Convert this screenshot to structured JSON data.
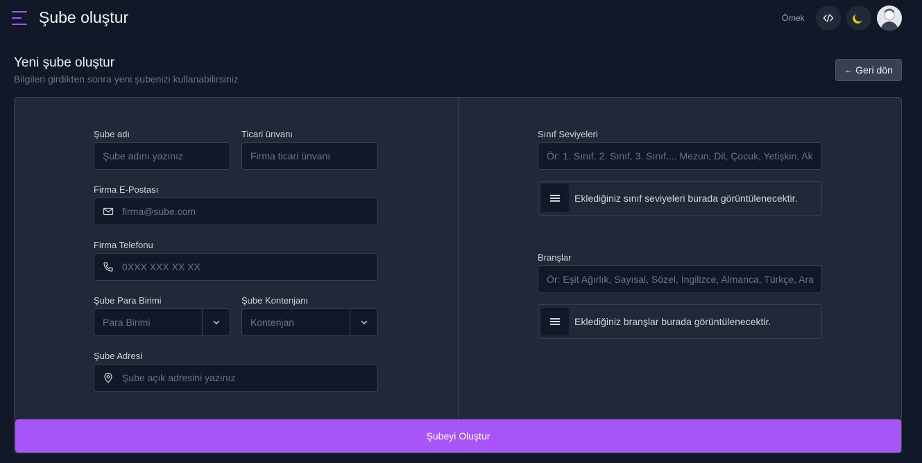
{
  "header": {
    "title": "Şube oluştur",
    "example_label": "Örnek"
  },
  "page": {
    "heading": "Yeni şube oluştur",
    "subheading": "Bilgileri girdikten sonra yeni şubenizi kullanabilirsiniz",
    "back_label": "Geri dön",
    "back_icon": "←"
  },
  "form": {
    "branch_name": {
      "label": "Şube adı",
      "placeholder": "Şube adını yazınız"
    },
    "trade_title": {
      "label": "Ticari ünvanı",
      "placeholder": "Firma ticari ünvanı"
    },
    "email": {
      "label": "Firma E-Postası",
      "placeholder": "firma@sube.com"
    },
    "phone": {
      "label": "Firma Telefonu",
      "placeholder": "0XXX XXX XX XX"
    },
    "currency": {
      "label": "Şube Para Birimi",
      "placeholder": "Para Birimi"
    },
    "quota": {
      "label": "Şube Kontenjanı",
      "placeholder": "Kontenjan"
    },
    "address": {
      "label": "Şube Adresi",
      "placeholder": "Şube açık adresini yazınız"
    },
    "class_levels": {
      "label": "Sınıf Seviyeleri",
      "placeholder": "Ör: 1. Sınıf, 2. Sınıf, 3. Sınıf.... Mezun, Dil, Çocuk, Yetişkin, Ak",
      "empty_text": "Eklediğiniz sınıf seviyeleri burada görüntülenecektir."
    },
    "branches": {
      "label": "Branşlar",
      "placeholder": "Ör: Eşit Ağırlık, Sayısal, Sözel, İngilizce, Almanca, Türkçe, Ara",
      "empty_text": "Eklediğiniz branşlar burada görüntülenecektir."
    },
    "submit_label": "Şubeyi Oluştur"
  },
  "colors": {
    "accent": "#a855f7",
    "background": "#111827",
    "card": "#1f2937",
    "moon": "#facc15"
  }
}
